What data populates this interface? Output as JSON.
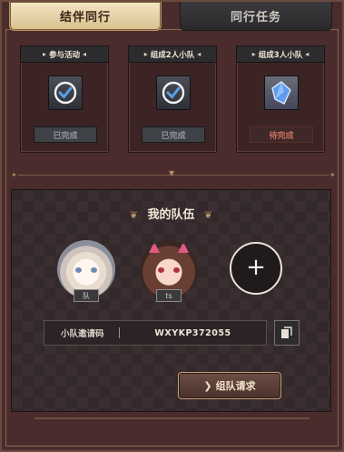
{
  "tabs": [
    {
      "label": "结伴同行",
      "active": true
    },
    {
      "label": "同行任务",
      "active": false
    }
  ],
  "tasks": [
    {
      "title": "参与活动",
      "status": "已完成",
      "icon": "checkmark-badge-icon"
    },
    {
      "title": "组成2人小队",
      "status": "已完成",
      "icon": "checkmark-badge-icon"
    },
    {
      "title": "组成3人小队",
      "status": "待完成",
      "icon": "blue-crystal-icon"
    }
  ],
  "team": {
    "title": "我的队伍",
    "members": [
      {
        "tag": "队",
        "icon": "avatar-white-hair"
      },
      {
        "tag": "ts",
        "icon": "avatar-pink-horns"
      }
    ],
    "add_icon": "+",
    "invite_label": "小队邀请码",
    "invite_code": "WXYKP372055",
    "copy_icon": "copy-icon",
    "form_button": "组队请求"
  },
  "colors": {
    "frame": "#4a2c2c",
    "tab_active": "#f3e6c4",
    "pending": "#c86e5e",
    "done": "#8f969c"
  }
}
